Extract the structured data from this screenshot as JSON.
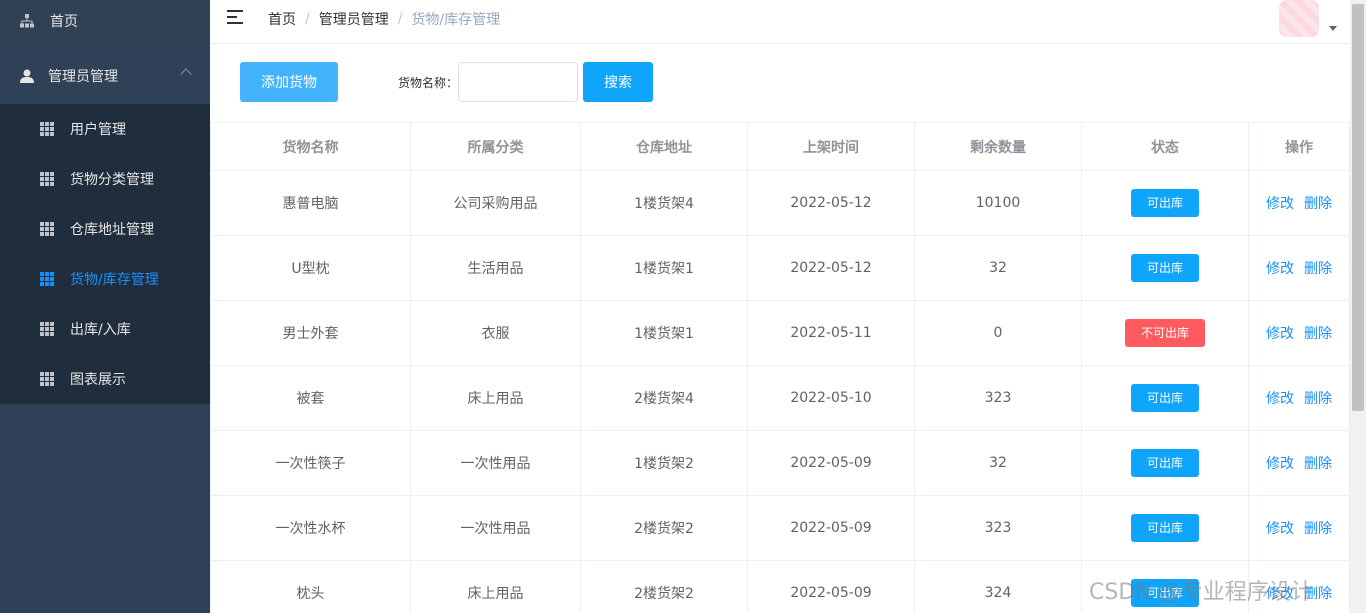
{
  "sidebar": {
    "home_label": "首页",
    "admin_label": "管理员管理",
    "items": [
      {
        "label": "用户管理",
        "active": false
      },
      {
        "label": "货物分类管理",
        "active": false
      },
      {
        "label": "仓库地址管理",
        "active": false
      },
      {
        "label": "货物/库存管理",
        "active": true
      },
      {
        "label": "出库/入库",
        "active": false
      },
      {
        "label": "图表展示",
        "active": false
      }
    ]
  },
  "breadcrumb": {
    "home": "首页",
    "sep": "/",
    "parent": "管理员管理",
    "current": "货物/库存管理"
  },
  "toolbar": {
    "add_label": "添加货物",
    "search_label": "货物名称：",
    "search_value": "",
    "search_button": "搜索"
  },
  "table": {
    "headers": [
      "货物名称",
      "所属分类",
      "仓库地址",
      "上架时间",
      "剩余数量",
      "状态",
      "操作"
    ],
    "edit_label": "修改",
    "delete_label": "删除",
    "rows": [
      {
        "name": "惠普电脑",
        "category": "公司采购用品",
        "location": "1楼货架4",
        "date": "2022-05-12",
        "qty": "10100",
        "status": "可出库",
        "ok": true
      },
      {
        "name": "U型枕",
        "category": "生活用品",
        "location": "1楼货架1",
        "date": "2022-05-12",
        "qty": "32",
        "status": "可出库",
        "ok": true
      },
      {
        "name": "男士外套",
        "category": "衣服",
        "location": "1楼货架1",
        "date": "2022-05-11",
        "qty": "0",
        "status": "不可出库",
        "ok": false
      },
      {
        "name": "被套",
        "category": "床上用品",
        "location": "2楼货架4",
        "date": "2022-05-10",
        "qty": "323",
        "status": "可出库",
        "ok": true
      },
      {
        "name": "一次性筷子",
        "category": "一次性用品",
        "location": "1楼货架2",
        "date": "2022-05-09",
        "qty": "32",
        "status": "可出库",
        "ok": true
      },
      {
        "name": "一次性水杯",
        "category": "一次性用品",
        "location": "2楼货架2",
        "date": "2022-05-09",
        "qty": "323",
        "status": "可出库",
        "ok": true
      },
      {
        "name": "枕头",
        "category": "床上用品",
        "location": "2楼货架2",
        "date": "2022-05-09",
        "qty": "324",
        "status": "可出库",
        "ok": true
      }
    ]
  },
  "watermark": "CSDN @专业程序设计",
  "colors": {
    "sidebar_bg": "#2e4156",
    "submenu_bg": "#1f2d3d",
    "active_menu": "#1890ff",
    "primary_button": "#0ea5fb",
    "status_ok": "#0ea5fb",
    "status_blocked": "#ff5a5f",
    "link": "#1890ff"
  },
  "icons": [
    "sitemap-icon",
    "user-icon",
    "chevron-up-icon",
    "grid-icon",
    "hamburger-menu-icon",
    "caret-down-icon"
  ]
}
